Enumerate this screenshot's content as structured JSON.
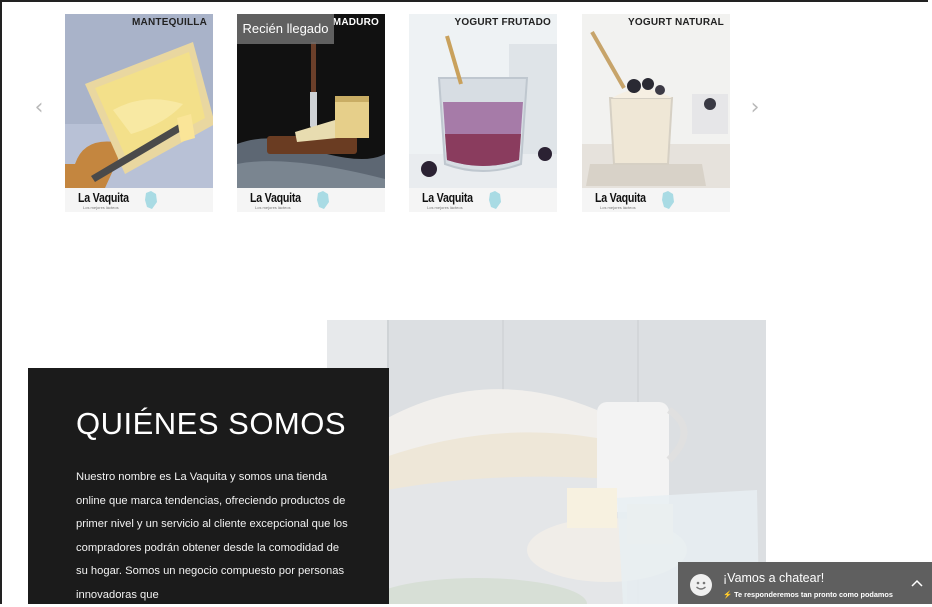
{
  "carousel": {
    "prev_icon": "‹",
    "next_icon": "›",
    "badge": "Recién llegado",
    "brand": "La Vaquita",
    "tagline": "Los mejores lácteos",
    "products": [
      {
        "title": "MANTEQUILLA"
      },
      {
        "title": "MADURO"
      },
      {
        "title": "YOGURT FRUTADO"
      },
      {
        "title": "YOGURT NATURAL"
      }
    ]
  },
  "about": {
    "heading": "QUIÉNES SOMOS",
    "body": "Nuestro nombre es La Vaquita y somos una tienda online que marca tendencias, ofreciendo productos de primer nivel y un servicio al cliente excepcional que los compradores podrán obtener desde la comodidad de su hogar. Somos un negocio compuesto por personas innovadoras que"
  },
  "chat": {
    "title": "¡Vamos a chatear!",
    "subtitle": "Te responderemos tan pronto como podamos"
  },
  "colors": {
    "about_bg": "#1b1b1b",
    "chat_bg": "#5f5f5f",
    "badge_bg": "#6e6e6e",
    "arrow": "#b9b9b9"
  }
}
